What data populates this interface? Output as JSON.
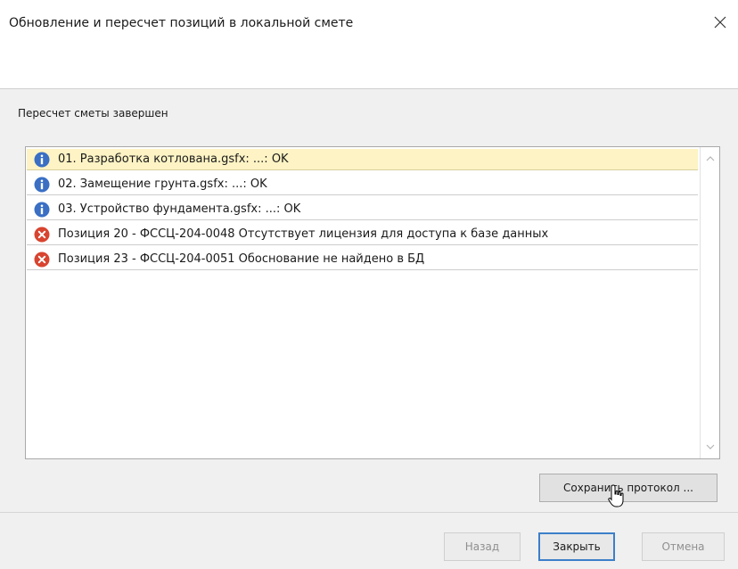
{
  "window": {
    "title": "Обновление и пересчет позиций в локальной смете"
  },
  "status_text": "Пересчет сметы завершен",
  "log": [
    {
      "icon": "info-icon",
      "text": "01. Разработка котлована.gsfx: ...: OK",
      "selected": true
    },
    {
      "icon": "info-icon",
      "text": "02. Замещение грунта.gsfx: ...: OK",
      "selected": false
    },
    {
      "icon": "info-icon",
      "text": "03. Устройство фундамента.gsfx: ...: OK",
      "selected": false
    },
    {
      "icon": "error-icon",
      "text": "Позиция 20 - ФССЦ-204-0048 Отсутствует лицензия для доступа к базе данных",
      "selected": false
    },
    {
      "icon": "error-icon",
      "text": "Позиция 23 - ФССЦ-204-0051 Обоснование не найдено в БД",
      "selected": false
    }
  ],
  "buttons": {
    "save_protocol": "Сохранить протокол ...",
    "back": "Назад",
    "close": "Закрыть",
    "cancel": "Отмена"
  },
  "colors": {
    "info": "#3a6fc4",
    "error": "#d8442f",
    "selected_row": "#fdf3c4",
    "default_button_border": "#3c7fc9"
  }
}
